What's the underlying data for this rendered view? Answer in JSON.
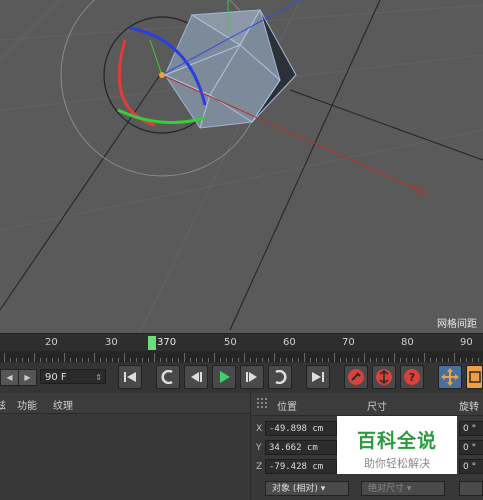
{
  "viewport": {
    "grid_label": "网格间距"
  },
  "timeline": {
    "tick_labels": [
      "20",
      "30",
      "50",
      "60",
      "70",
      "80",
      "90"
    ],
    "playhead_label": "370"
  },
  "transport": {
    "frame_value": "90 F",
    "buttons": [
      "go-to-start",
      "previous-key",
      "previous-frame",
      "play",
      "next-frame",
      "next-key",
      "go-to-end",
      "record",
      "auto-key",
      "keyframe-help",
      "move-tool"
    ]
  },
  "left_panel": {
    "menu": [
      "兹",
      "功能",
      "纹理"
    ]
  },
  "coordinates": {
    "headers": {
      "position": "位置",
      "size": "尺寸",
      "rotation": "旋转"
    },
    "rows": [
      {
        "axis": "X",
        "value": "-49.898 cm",
        "rot": "0 °"
      },
      {
        "axis": "Y",
        "value": "34.662 cm",
        "rot": "0 °"
      },
      {
        "axis": "Z",
        "value": "-79.428 cm",
        "rot": "0 °"
      }
    ],
    "mode_dropdown": "对象 (相对) ▾",
    "size_dropdown": "绝对尺寸 ▾"
  },
  "watermark": {
    "title": "百科全说",
    "subtitle": "助你轻松解决"
  }
}
